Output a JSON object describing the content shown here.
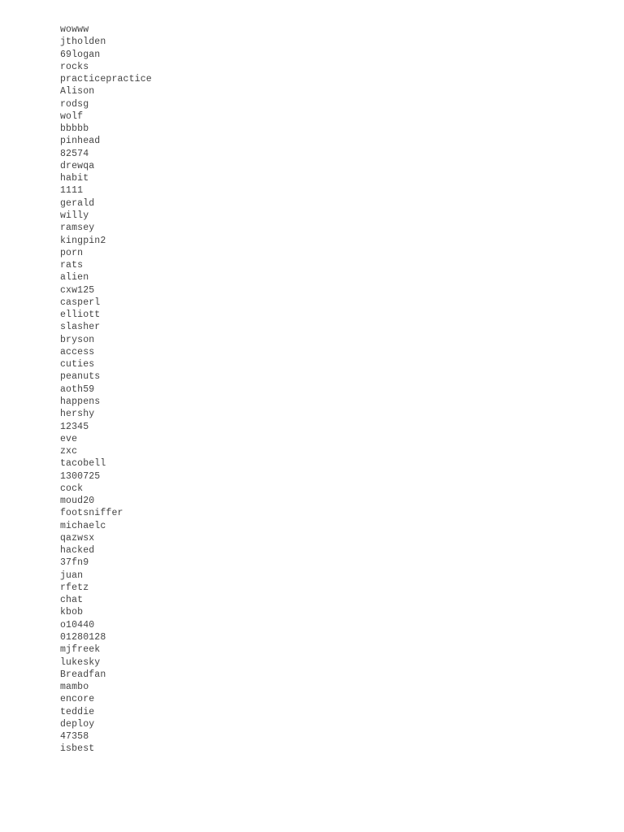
{
  "document": {
    "type": "plain-text-listing",
    "background_color": "#ffffff",
    "text_color": "#434343",
    "line_count": 60,
    "lines": [
      "wowww",
      "jtholden",
      "69logan",
      "rocks",
      "practicepractice",
      "Alison",
      "rodsg",
      "wolf",
      "bbbbb",
      "pinhead",
      "82574",
      "drewqa",
      "habit",
      "1111",
      "gerald",
      "willy",
      "ramsey",
      "kingpin2",
      "porn",
      "rats",
      "alien",
      "cxw125",
      "casperl",
      "elliott",
      "slasher",
      "bryson",
      "access",
      "cuties",
      "peanuts",
      "aoth59",
      "happens",
      "hershy",
      "12345",
      "eve",
      "zxc",
      "tacobell",
      "1300725",
      "cock",
      "moud20",
      "footsniffer",
      "michaelc",
      "qazwsx",
      "hacked",
      "37fn9",
      "juan",
      "rfetz",
      "chat",
      "kbob",
      "o10440",
      "01280128",
      "mjfreek",
      "lukesky",
      "Breadfan",
      "mambo",
      "encore",
      "teddie",
      "deploy",
      "47358",
      "isbest"
    ]
  }
}
